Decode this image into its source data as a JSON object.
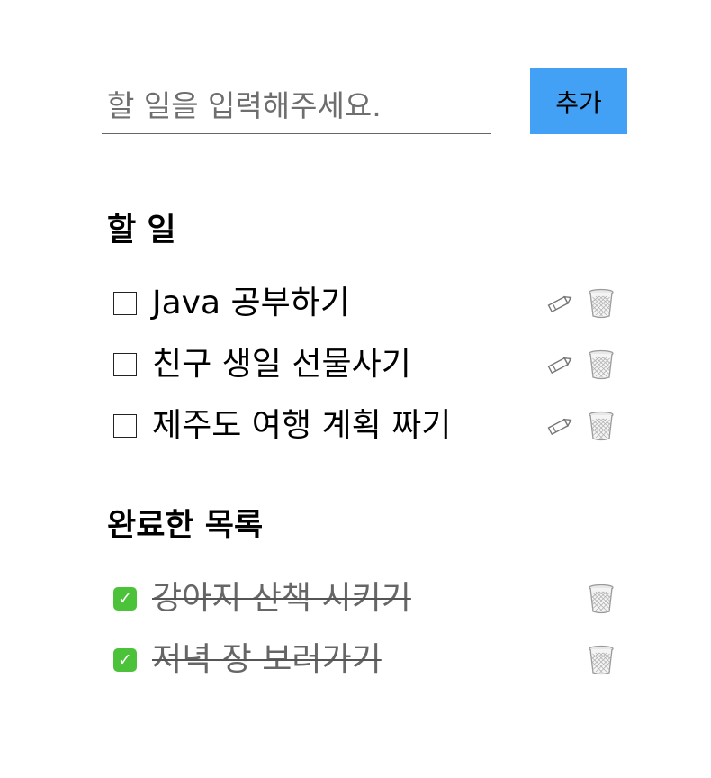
{
  "form": {
    "placeholder": "할 일을 입력해주세요.",
    "value": "",
    "add_label": "추가"
  },
  "todo": {
    "title": "할 일",
    "items": [
      {
        "text": "Java 공부하기",
        "done": false
      },
      {
        "text": "친구 생일 선물사기",
        "done": false
      },
      {
        "text": "제주도 여행 계획 짜기",
        "done": false
      }
    ]
  },
  "completed": {
    "title": "완료한 목록",
    "items": [
      {
        "text": "강아지 산책 시키기",
        "done": true
      },
      {
        "text": "저녁 장 보러가기",
        "done": true
      }
    ]
  },
  "icons": {
    "edit": "pencil-icon",
    "delete": "wastebasket-icon",
    "check": "check-mark-icon"
  },
  "colors": {
    "accent": "#42a1f5",
    "check": "#4cc23a",
    "done_text": "#666666"
  }
}
